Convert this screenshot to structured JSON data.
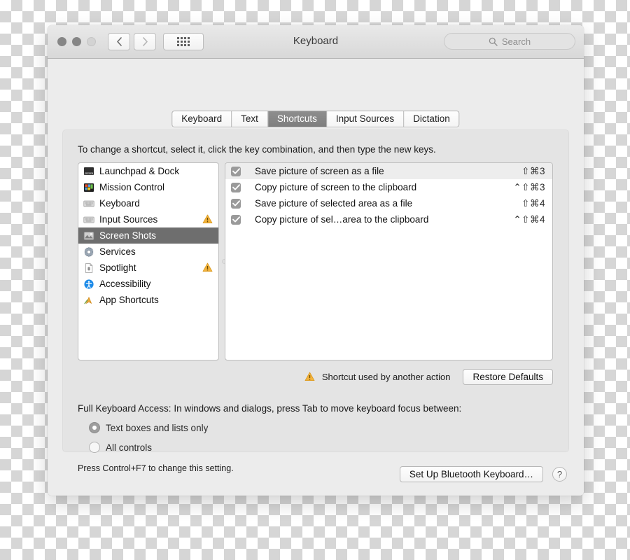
{
  "window": {
    "title": "Keyboard",
    "traffic_lights": [
      "close-button",
      "minimize-button",
      "zoom-button"
    ],
    "nav": {
      "back": "back-icon",
      "forward": "forward-icon",
      "grid": "show-all-icon"
    },
    "search": {
      "placeholder": "Search",
      "value": "",
      "icon": "search-icon"
    }
  },
  "tabs": [
    {
      "label": "Keyboard",
      "active": false
    },
    {
      "label": "Text",
      "active": false
    },
    {
      "label": "Shortcuts",
      "active": true
    },
    {
      "label": "Input Sources",
      "active": false
    },
    {
      "label": "Dictation",
      "active": false
    }
  ],
  "hint": "To change a shortcut, select it, click the key combination, and then type the new keys.",
  "sidebar": {
    "items": [
      {
        "label": "Launchpad & Dock",
        "icon": "launchpad-dock-icon",
        "selected": false,
        "warning": false
      },
      {
        "label": "Mission Control",
        "icon": "mission-control-icon",
        "selected": false,
        "warning": false
      },
      {
        "label": "Keyboard",
        "icon": "keyboard-icon",
        "selected": false,
        "warning": false
      },
      {
        "label": "Input Sources",
        "icon": "keyboard-icon",
        "selected": false,
        "warning": true
      },
      {
        "label": "Screen Shots",
        "icon": "screenshots-icon",
        "selected": true,
        "warning": false
      },
      {
        "label": "Services",
        "icon": "services-gear-icon",
        "selected": false,
        "warning": false
      },
      {
        "label": "Spotlight",
        "icon": "spotlight-icon",
        "selected": false,
        "warning": true
      },
      {
        "label": "Accessibility",
        "icon": "accessibility-icon",
        "selected": false,
        "warning": false
      },
      {
        "label": "App Shortcuts",
        "icon": "app-shortcuts-icon",
        "selected": false,
        "warning": false
      }
    ]
  },
  "shortcuts": {
    "rows": [
      {
        "label": "Save picture of screen as a file",
        "combo": "⇧⌘3",
        "checked": true,
        "highlighted": true
      },
      {
        "label": "Copy picture of screen to the clipboard",
        "combo": "⌃⇧⌘3",
        "checked": true,
        "highlighted": false
      },
      {
        "label": "Save picture of selected area as a file",
        "combo": "⇧⌘4",
        "checked": true,
        "highlighted": false
      },
      {
        "label": "Copy picture of sel…area to the clipboard",
        "combo": "⌃⇧⌘4",
        "checked": true,
        "highlighted": false
      }
    ]
  },
  "warning_row": {
    "icon": "warning-triangle-icon",
    "text": "Shortcut used by another action",
    "restore_label": "Restore Defaults"
  },
  "full_keyboard_access": {
    "heading": "Full Keyboard Access: In windows and dialogs, press Tab to move keyboard focus between:",
    "options": [
      {
        "label": "Text boxes and lists only",
        "selected": true
      },
      {
        "label": "All controls",
        "selected": false
      }
    ],
    "note": "Press Control+F7 to change this setting."
  },
  "footer": {
    "bluetooth_label": "Set Up Bluetooth Keyboard…",
    "help_label": "?"
  },
  "colors": {
    "window_bg": "#ececec",
    "panel_bg": "#e4e4e4",
    "selection": "#6e6e6e",
    "active_tab": "#8e8e8e",
    "warning": "#f3b33c",
    "checkbox": "#9a9a9a"
  }
}
